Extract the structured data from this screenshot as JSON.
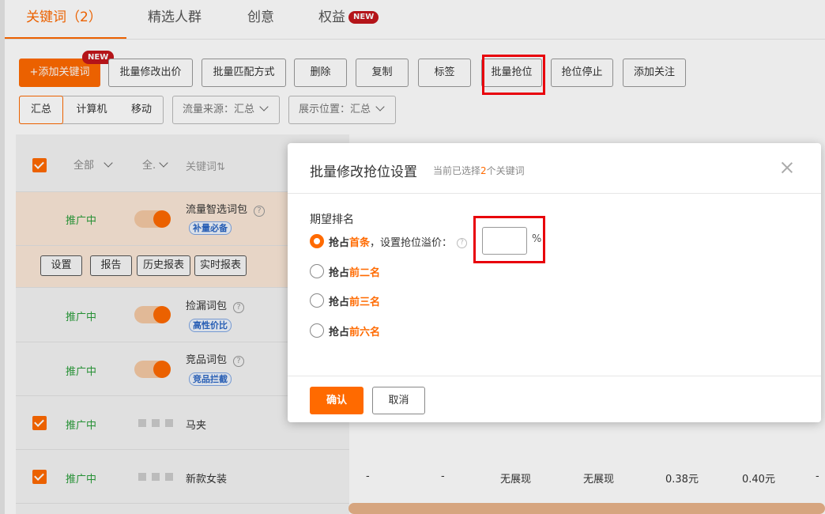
{
  "tabs": [
    {
      "label": "关键词（2）"
    },
    {
      "label": "精选人群"
    },
    {
      "label": "创意"
    },
    {
      "label": "权益",
      "badge": "NEW"
    }
  ],
  "toolbar": {
    "add_keyword": "+添加关键词",
    "add_keyword_badge": "NEW",
    "batch_bid": "批量修改出价",
    "batch_match": "批量匹配方式",
    "delete": "删除",
    "copy": "复制",
    "tag": "标签",
    "batch_rank": "批量抢位",
    "stop_rank": "抢位停止",
    "add_follow": "添加关注"
  },
  "filters": {
    "device_tabs": [
      "汇总",
      "计算机",
      "移动"
    ],
    "traffic_source": "流量来源：汇总",
    "display_position": "展示位置：汇总"
  },
  "table": {
    "header": {
      "filter_all": "全部",
      "filter_all2": "全.",
      "keyword_col": "关键词⇅"
    },
    "rows": [
      {
        "status": "推广中",
        "name": "流量智选词包",
        "tag": "补量必备"
      },
      {
        "status": "推广中",
        "name": "捡漏词包",
        "tag": "高性价比"
      },
      {
        "status": "推广中",
        "name": "竞品词包",
        "tag": "竞品拦截"
      },
      {
        "status": "推广中",
        "name": "马夹"
      },
      {
        "status": "推广中",
        "name": "新款女装",
        "cells": [
          "-",
          "-",
          "无展现",
          "无展现",
          "0.38元",
          "0.40元",
          "-"
        ]
      }
    ],
    "row_actions": [
      "设置",
      "报告",
      "历史报表",
      "实时报表"
    ]
  },
  "modal": {
    "title": "批量修改抢位设置",
    "subtitle_prefix": "当前已选择",
    "subtitle_count": "2",
    "subtitle_suffix": "个关键词",
    "expected_rank_label": "期望排名",
    "options": [
      {
        "prefix": "抢占",
        "highlight": "首条",
        "suffix": "，设置抢位溢价：",
        "checked": true
      },
      {
        "prefix": "抢占",
        "highlight": "前二名",
        "checked": false
      },
      {
        "prefix": "抢占",
        "highlight": "前三名",
        "checked": false
      },
      {
        "prefix": "抢占",
        "highlight": "前六名",
        "checked": false
      }
    ],
    "premium_value": "",
    "percent": "%",
    "confirm": "确认",
    "cancel": "取消"
  },
  "colors": {
    "accent": "#ff6a00",
    "status_green": "#2a9d3a",
    "badge_red": "#c4161c",
    "highlight_red": "#e8000b"
  }
}
